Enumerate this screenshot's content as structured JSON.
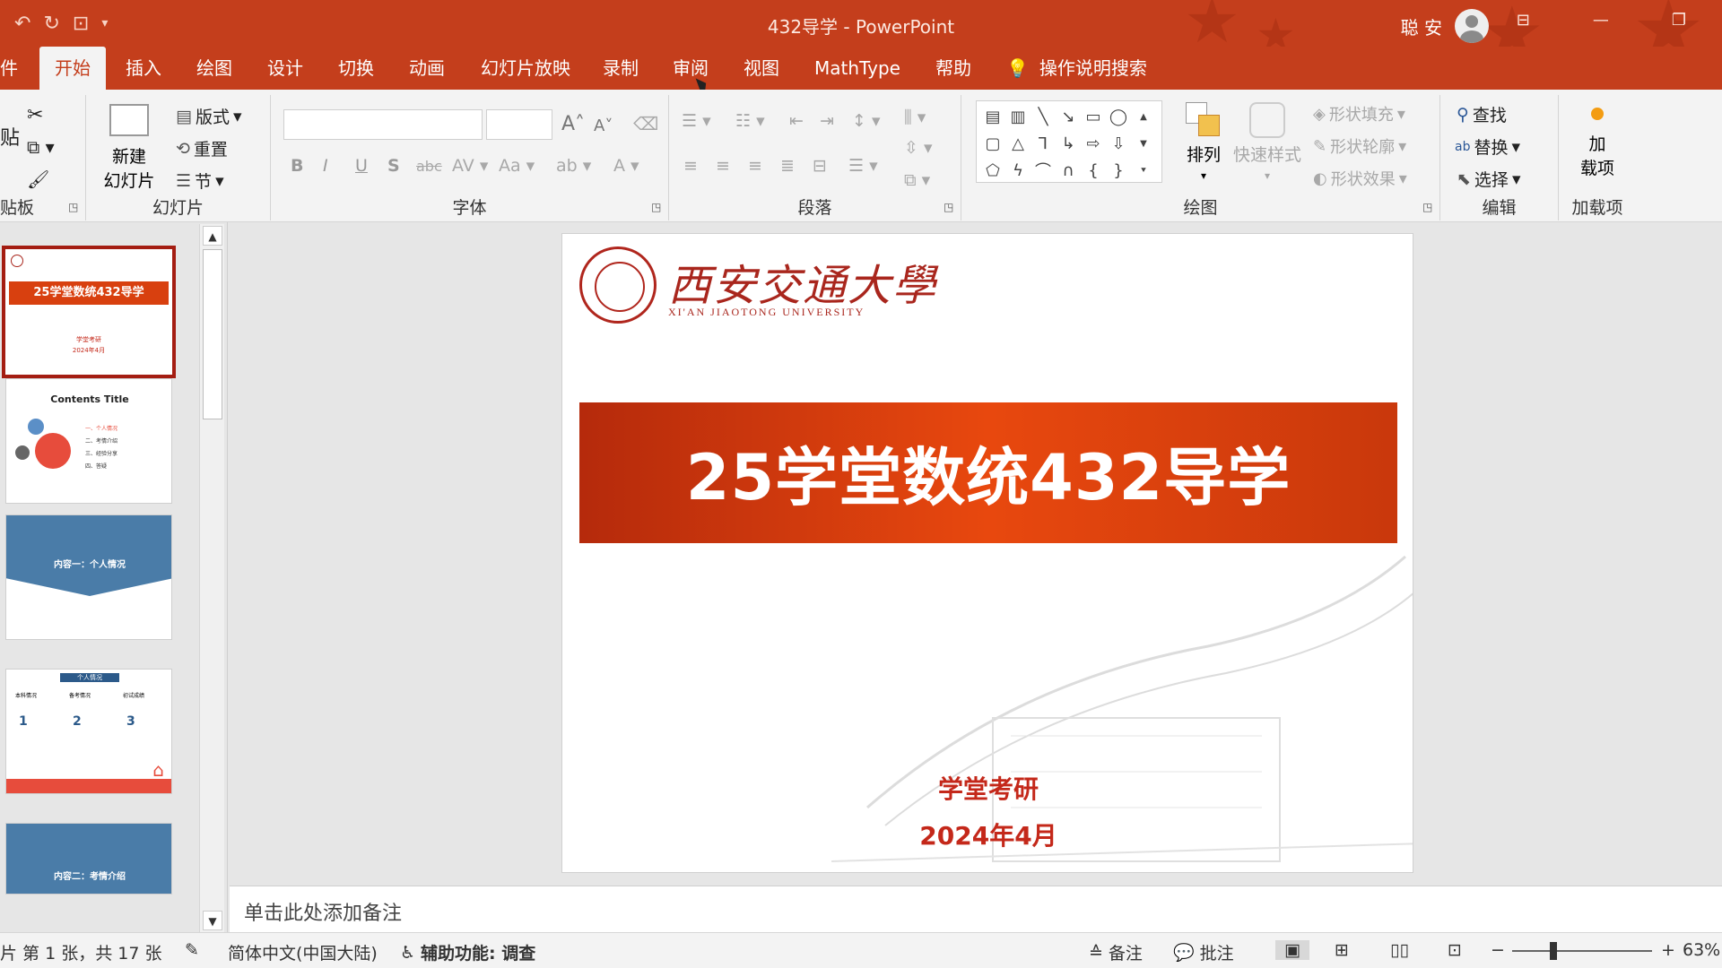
{
  "window": {
    "title": "432导学  -  PowerPoint",
    "user": "聪 安",
    "colors": {
      "accent": "#c43e1c",
      "ribbon_bg": "#f3f3f3",
      "banner": "#e0440e",
      "subtitle": "#c4281a"
    }
  },
  "qat": {
    "undo": "↶",
    "redo": "↻",
    "present": "⊡",
    "customize": "▾"
  },
  "tabs": [
    {
      "label": "件"
    },
    {
      "label": "开始"
    },
    {
      "label": "插入"
    },
    {
      "label": "绘图"
    },
    {
      "label": "设计"
    },
    {
      "label": "切换"
    },
    {
      "label": "动画"
    },
    {
      "label": "幻灯片放映"
    },
    {
      "label": "录制"
    },
    {
      "label": "审阅"
    },
    {
      "label": "视图"
    },
    {
      "label": "MathType"
    },
    {
      "label": "帮助"
    }
  ],
  "tell_me": "操作说明搜索",
  "ribbon": {
    "clipboard": {
      "label": "贴板",
      "paste": "贴"
    },
    "slides": {
      "label": "幻灯片",
      "new_slide_1": "新建",
      "new_slide_2": "幻灯片",
      "layout": "版式",
      "reset": "重置",
      "section": "节"
    },
    "font": {
      "label": "字体"
    },
    "paragraph": {
      "label": "段落"
    },
    "drawing": {
      "label": "绘图",
      "arrange": "排列",
      "quick_styles": "快速样式",
      "shape_fill": "形状填充",
      "shape_outline": "形状轮廓",
      "shape_effects": "形状效果"
    },
    "editing": {
      "label": "编辑",
      "find": "查找",
      "replace": "替换",
      "select": "选择"
    },
    "addins": {
      "label": "加载项",
      "add_1": "加",
      "add_2": "载项"
    }
  },
  "thumbnails": [
    {
      "title": "25学堂数统432导学",
      "sub1": "学堂考研",
      "sub2": "2024年4月"
    },
    {
      "title": "Contents  Title",
      "items": [
        "一、个人情况",
        "二、考情介绍",
        "三、经验分享",
        "四、答疑"
      ]
    },
    {
      "title": "内容一：个人情况"
    },
    {
      "title": "个人情况",
      "cols": [
        "本科情况",
        "备考情况",
        "初试成绩"
      ],
      "nums": [
        "1",
        "2",
        "3"
      ]
    },
    {
      "title": "内容二：考情介绍"
    }
  ],
  "slide": {
    "logo_cn": "西安交通大學",
    "logo_en": "XI'AN JIAOTONG UNIVERSITY",
    "title": "25学堂数统432导学",
    "subtitle1": "学堂考研",
    "subtitle2": "2024年4月"
  },
  "notes_placeholder": "单击此处添加备注",
  "status": {
    "slide_info": "片 第 1 张，共 17 张",
    "language": "简体中文(中国大陆)",
    "accessibility": "辅助功能: 调查",
    "notes": "备注",
    "comments": "批注",
    "zoom": "63%"
  }
}
